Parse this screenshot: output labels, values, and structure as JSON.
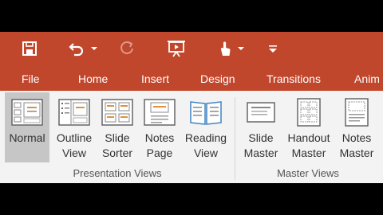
{
  "quick_access": {
    "save_icon": "save-icon",
    "undo_icon": "undo-icon",
    "redo_icon": "redo-icon",
    "present_icon": "present-from-beginning-icon",
    "touch_icon": "touch-mouse-mode-icon",
    "customize_icon": "customize-toolbar-icon"
  },
  "tabs": [
    {
      "label": "File"
    },
    {
      "label": "Home"
    },
    {
      "label": "Insert"
    },
    {
      "label": "Design"
    },
    {
      "label": "Transitions"
    },
    {
      "label": "Anim"
    }
  ],
  "groups": {
    "presentation_views": {
      "label": "Presentation Views",
      "buttons": [
        {
          "line1": "Normal",
          "line2": ""
        },
        {
          "line1": "Outline",
          "line2": "View"
        },
        {
          "line1": "Slide",
          "line2": "Sorter"
        },
        {
          "line1": "Notes",
          "line2": "Page"
        },
        {
          "line1": "Reading",
          "line2": "View"
        }
      ]
    },
    "master_views": {
      "label": "Master Views",
      "buttons": [
        {
          "line1": "Slide",
          "line2": "Master"
        },
        {
          "line1": "Handout",
          "line2": "Master"
        },
        {
          "line1": "Notes",
          "line2": "Master"
        }
      ]
    }
  },
  "colors": {
    "accent": "#c0462c",
    "ribbon_bg": "#f3f3f3",
    "selected_bg": "#c6c6c6"
  }
}
